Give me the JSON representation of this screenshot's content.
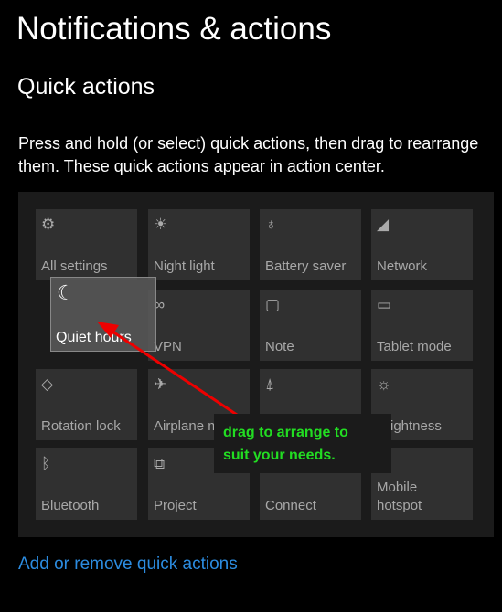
{
  "page_title": "Notifications & actions",
  "section_title": "Quick actions",
  "description_lines": [
    "Press and hold (or select) quick actions, then drag to rearrange",
    "them. These quick actions appear in action center."
  ],
  "tiles": [
    {
      "label": "All settings",
      "icon": "gear-icon",
      "glyph": "⚙"
    },
    {
      "label": "Night light",
      "icon": "night-light-icon",
      "glyph": "☀"
    },
    {
      "label": "Battery saver",
      "icon": "leaf-icon",
      "glyph": "♁"
    },
    {
      "label": "Network",
      "icon": "network-icon",
      "glyph": "◢"
    },
    {
      "label": "",
      "icon": "empty",
      "glyph": ""
    },
    {
      "label": "VPN",
      "icon": "vpn-icon",
      "glyph": "∞"
    },
    {
      "label": "Note",
      "icon": "note-icon",
      "glyph": "▢"
    },
    {
      "label": "Tablet mode",
      "icon": "tablet-mode-icon",
      "glyph": "▭"
    },
    {
      "label": "Rotation lock",
      "icon": "rotation-lock-icon",
      "glyph": "◇"
    },
    {
      "label": "Airplane mode",
      "icon": "airplane-icon",
      "glyph": "✈"
    },
    {
      "label": "",
      "icon": "location-icon",
      "glyph": "⍋"
    },
    {
      "label": "Brightness",
      "icon": "brightness-icon",
      "glyph": "☼"
    },
    {
      "label": "Bluetooth",
      "icon": "bluetooth-icon",
      "glyph": "ᛒ"
    },
    {
      "label": "Project",
      "icon": "project-icon",
      "glyph": "⧉"
    },
    {
      "label": "Connect",
      "icon": "connect-icon",
      "glyph": ""
    },
    {
      "label": "Mobile hotspot",
      "icon": "hotspot-icon",
      "glyph": ""
    }
  ],
  "dragged_tile": {
    "label": "Quiet hours",
    "icon": "moon-icon",
    "glyph": "☾"
  },
  "callout_lines": [
    "drag to arrange to",
    "suit your needs."
  ],
  "link": "Add or remove quick actions",
  "colors": {
    "accent_link": "#2c8ce0",
    "callout_text": "#22dd22",
    "arrow": "#ff0000"
  }
}
